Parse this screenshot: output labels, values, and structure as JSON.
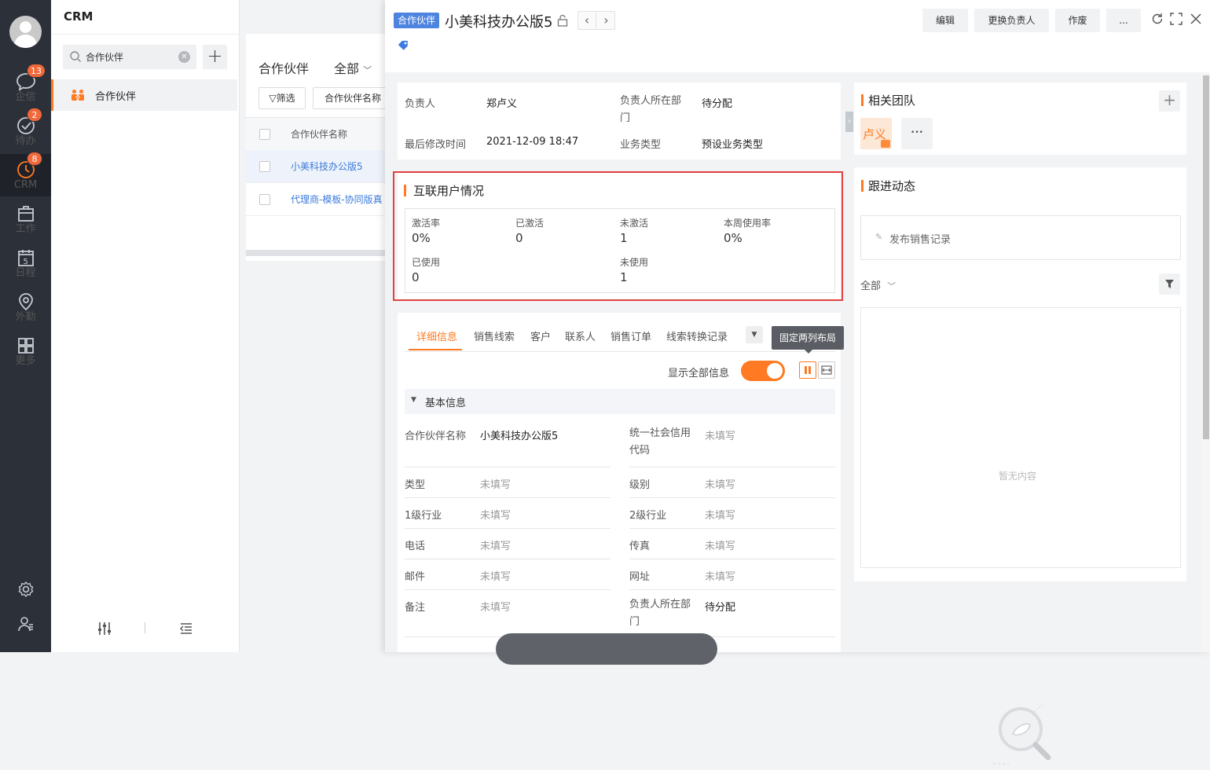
{
  "rail": {
    "items": [
      {
        "label": "企信",
        "badge": "13"
      },
      {
        "label": "待办",
        "badge": "2"
      },
      {
        "label": "CRM",
        "badge": "8"
      },
      {
        "label": "工作"
      },
      {
        "label": "日程"
      },
      {
        "label": "外勤"
      },
      {
        "label": "更多"
      }
    ]
  },
  "nav": {
    "title": "CRM",
    "search_value": "合作伙伴",
    "menu_item": "合作伙伴"
  },
  "list": {
    "title": "合作伙伴",
    "scope": "全部",
    "filter_label": "筛选",
    "column_button": "合作伙伴名称",
    "header": "合作伙伴名称",
    "rows": [
      "小美科技办公版5",
      "代理商-模板-协同版真"
    ]
  },
  "detail": {
    "tag": "合作伙伴",
    "title": "小美科技办公版5",
    "buttons": {
      "edit": "编辑",
      "change_owner": "更换负责人",
      "void": "作废",
      "more": "..."
    },
    "summary": {
      "owner_label": "负责人",
      "owner_value": "郑卢义",
      "dept_label": "负责人所在部门",
      "dept_value": "待分配",
      "modified_label": "最后修改时间",
      "modified_value": "2021-12-09 18:47",
      "biztype_label": "业务类型",
      "biztype_value": "预设业务类型"
    },
    "interconnect": {
      "title": "互联用户情况",
      "stats": [
        {
          "label": "激活率",
          "value": "0%"
        },
        {
          "label": "已激活",
          "value": "0"
        },
        {
          "label": "未激活",
          "value": "1"
        },
        {
          "label": "本周使用率",
          "value": "0%"
        },
        {
          "label": "已使用",
          "value": "0"
        },
        {
          "label": "未使用",
          "value": "1"
        }
      ]
    },
    "tabs": [
      "详细信息",
      "销售线索",
      "客户",
      "联系人",
      "销售订单",
      "线索转换记录"
    ],
    "tooltip": "固定两列布局",
    "show_all_label": "显示全部信息",
    "basic_info_title": "基本信息",
    "fields": [
      {
        "label": "合作伙伴名称",
        "value": "小美科技办公版5",
        "label2": "统一社会信用代码",
        "value2": "未填写"
      },
      {
        "label": "类型",
        "value": "未填写",
        "label2": "级别",
        "value2": "未填写"
      },
      {
        "label": "1级行业",
        "value": "未填写",
        "label2": "2级行业",
        "value2": "未填写"
      },
      {
        "label": "电话",
        "value": "未填写",
        "label2": "传真",
        "value2": "未填写"
      },
      {
        "label": "邮件",
        "value": "未填写",
        "label2": "网址",
        "value2": "未填写"
      },
      {
        "label": "备注",
        "value": "未填写",
        "label2": "负责人所在部门",
        "value2": "待分配"
      }
    ],
    "team": {
      "title": "相关团队",
      "member": "卢义",
      "more": "•••"
    },
    "follow": {
      "title": "跟进动态",
      "post_label": "发布销售记录",
      "scope": "全部",
      "empty": "暂无内容"
    }
  }
}
